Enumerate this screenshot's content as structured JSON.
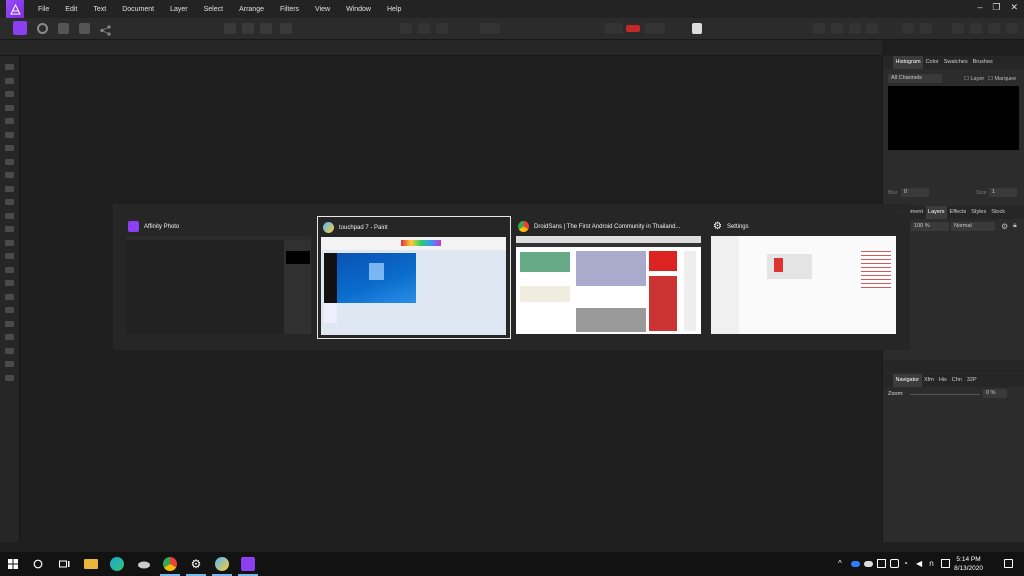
{
  "menubar": {
    "items": [
      "File",
      "Edit",
      "Text",
      "Document",
      "Layer",
      "Select",
      "Arrange",
      "Filters",
      "View",
      "Window",
      "Help"
    ]
  },
  "panels": {
    "top_tabs": [
      "Histogram",
      "Color",
      "Swatches",
      "Brushes"
    ],
    "channels_select": "All Channels",
    "layer_label": "Layer",
    "marquee_label": "Marquee",
    "blur_label": "Blur",
    "blur_value": "0",
    "size_label": "Size",
    "size_value": "1",
    "middle_tabs": [
      "Adjustment",
      "Layers",
      "Effects",
      "Styles",
      "Stock"
    ],
    "opacity_value": "100 %",
    "blend_mode": "Normal",
    "bottom_tabs": [
      "Navigator",
      "Xfm",
      "His",
      "Chn",
      "32P"
    ],
    "zoom_label": "Zoom:",
    "zoom_value": "0 %"
  },
  "switcher": {
    "items": [
      {
        "title": "Affinity Photo",
        "icon": "affinity-photo-icon"
      },
      {
        "title": "touchpad 7 - Paint",
        "icon": "paint-icon"
      },
      {
        "title": "DroidSans | The First Android Community in Thailand...",
        "icon": "chrome-icon"
      },
      {
        "title": "Settings",
        "icon": "settings-gear-icon"
      }
    ]
  },
  "taskbar": {
    "time": "5:14 PM",
    "date": "8/13/2020"
  },
  "colors": {
    "affinity_purple": "#8c3ff0",
    "windows_blue": "#0a6ccc",
    "taskbar_accent": "#76b9ed"
  }
}
